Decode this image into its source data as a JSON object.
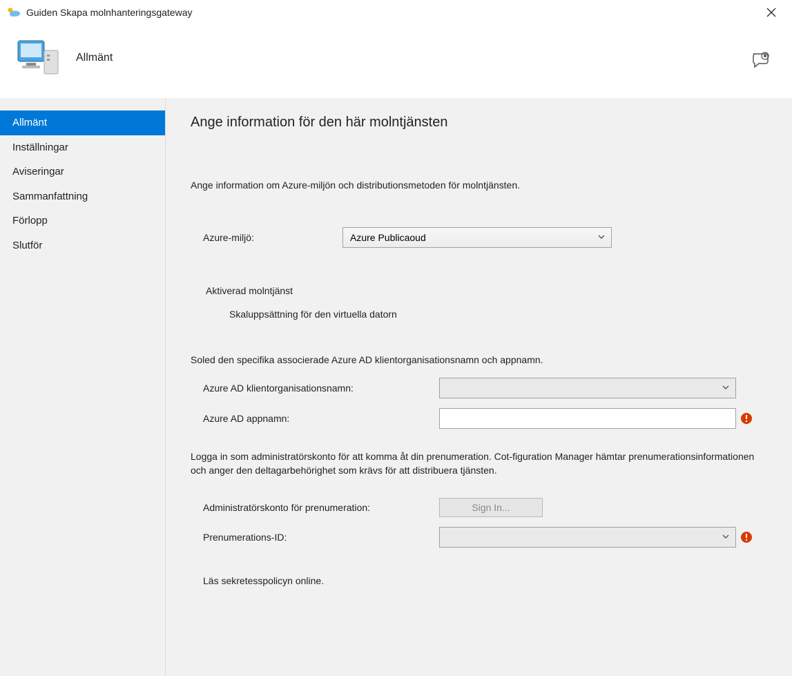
{
  "titlebar": {
    "title": "Guiden Skapa molnhanteringsgateway"
  },
  "header": {
    "title": "Allmänt"
  },
  "sidebar": {
    "items": [
      {
        "label": "Allmänt",
        "active": true
      },
      {
        "label": "Inställningar",
        "active": false
      },
      {
        "label": "Aviseringar",
        "active": false
      },
      {
        "label": "Sammanfattning",
        "active": false
      },
      {
        "label": "Förlopp",
        "active": false
      },
      {
        "label": "Slutför",
        "active": false
      }
    ]
  },
  "main": {
    "page_title": "Ange information för den här molntjänsten",
    "intro": "Ange information om Azure-miljön och distributionsmetoden för molntjänsten.",
    "azure_env_label": "Azure-miljö:",
    "azure_env_value": "Azure Publicaoud",
    "enabled_service_label": "Aktiverad molntjänst",
    "scale_set_label": "Skaluppsättning för den virtuella datorn",
    "soled_text": "Soled den specifika associerade Azure AD klientorganisationsnamn och appnamn.",
    "tenant_label": "Azure AD klientorganisationsnamn:",
    "tenant_value": "",
    "appname_label": "Azure AD appnamn:",
    "appname_value": "",
    "login_text": "Logga in som administratörskonto för att komma åt din prenumeration. Cot-figuration Manager hämtar prenumerationsinformationen och anger den deltagarbehörighet som krävs för att distribuera tjänsten.",
    "admin_label": "Administratörskonto för prenumeration:",
    "signin_label": "Sign In...",
    "sub_id_label": "Prenumerations-ID:",
    "sub_id_value": "",
    "privacy_link": "Läs sekretesspolicyn online."
  }
}
